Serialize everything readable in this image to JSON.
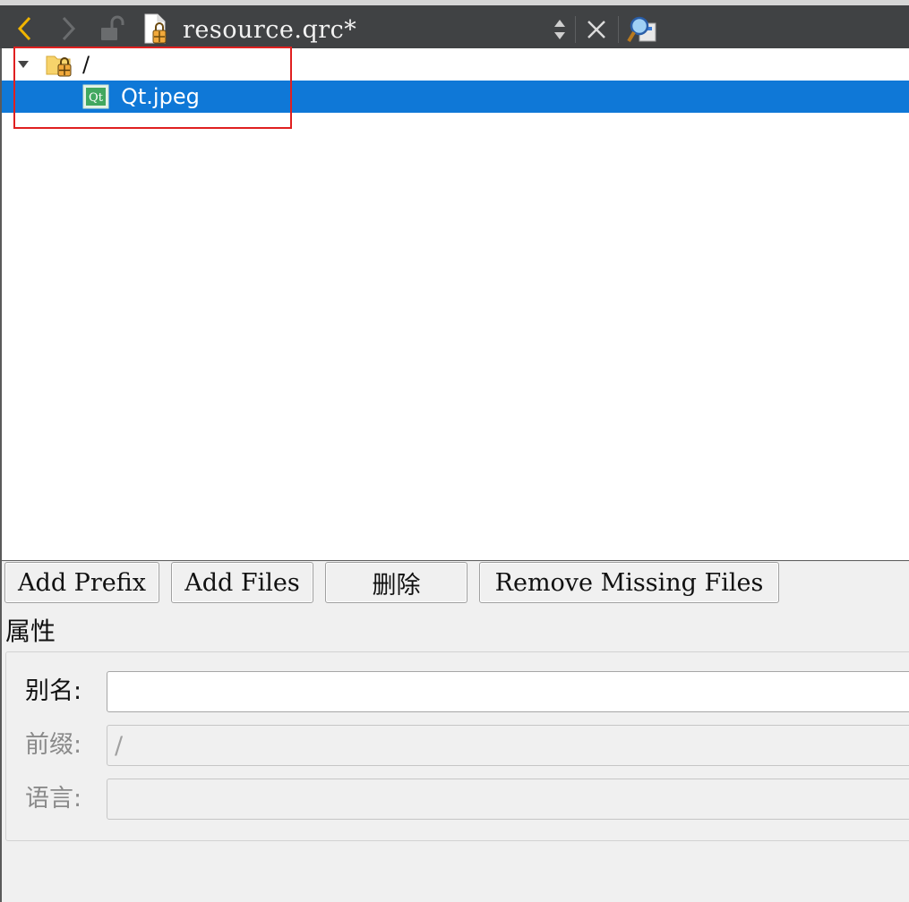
{
  "toolbar": {
    "file_title": "resource.qrc*"
  },
  "tree": {
    "prefix_label": "/",
    "file_label": "Qt.jpeg",
    "file_icon_text": "Qt"
  },
  "buttons": {
    "add_prefix": "Add Prefix",
    "add_files": "Add Files",
    "remove": "删除",
    "remove_missing": "Remove Missing Files"
  },
  "properties": {
    "title": "属性",
    "alias_label": "别名:",
    "alias_value": "",
    "prefix_label": "前缀:",
    "prefix_value": "/",
    "language_label": "语言:",
    "language_value": ""
  },
  "colors": {
    "toolbar_bg": "#404244",
    "selection": "#0f78d7",
    "highlight_box": "#e02020",
    "back_arrow": "#f0b400"
  }
}
